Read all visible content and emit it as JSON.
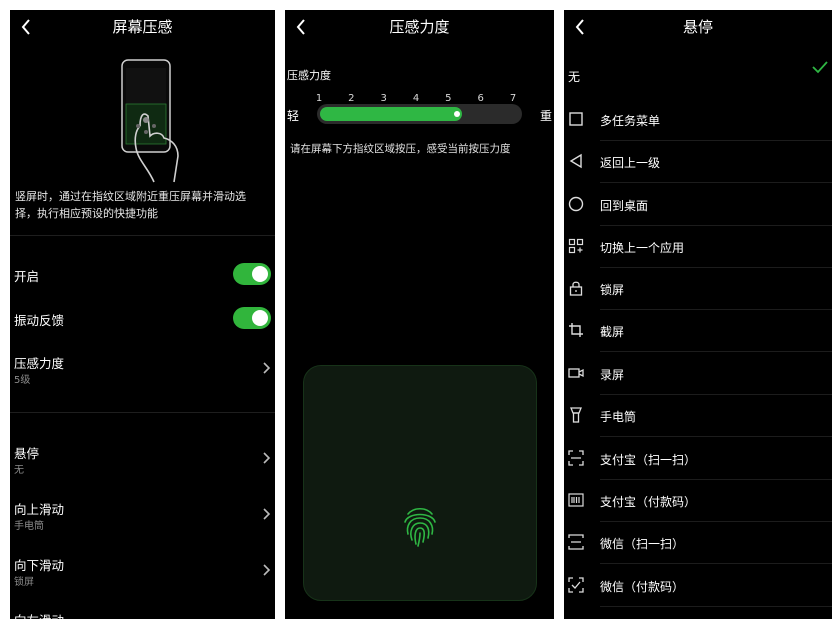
{
  "panel1": {
    "title": "屏幕压感",
    "description": "竖屏时，通过在指纹区域附近重压屏幕并滑动选择，执行相应预设的快捷功能",
    "enable_label": "开启",
    "vibration_label": "振动反馈",
    "pressure_label": "压感力度",
    "pressure_value": "5级",
    "hover_label": "悬停",
    "hover_value": "无",
    "swipe_up_label": "向上滑动",
    "swipe_up_value": "手电筒",
    "swipe_down_label": "向下滑动",
    "swipe_down_value": "锁屏",
    "swipe_left_label": "向左滑动",
    "accent_color": "#31b53c"
  },
  "panel2": {
    "title": "压感力度",
    "section_label": "压感力度",
    "ticks": [
      "1",
      "2",
      "3",
      "4",
      "5",
      "6",
      "7"
    ],
    "light_label": "轻",
    "heavy_label": "重",
    "level": 5,
    "level_max": 7,
    "hint": "请在屏幕下方指纹区域按压，感受当前按压力度"
  },
  "panel3": {
    "title": "悬停",
    "options": [
      {
        "label": "无",
        "icon": "none",
        "selected": true
      },
      {
        "label": "多任务菜单",
        "icon": "square-icon"
      },
      {
        "label": "返回上一级",
        "icon": "triangle-back-icon"
      },
      {
        "label": "回到桌面",
        "icon": "circle-home-icon"
      },
      {
        "label": "切换上一个应用",
        "icon": "grid-switch-icon"
      },
      {
        "label": "锁屏",
        "icon": "lock-icon"
      },
      {
        "label": "截屏",
        "icon": "crop-icon"
      },
      {
        "label": "录屏",
        "icon": "video-icon"
      },
      {
        "label": "手电筒",
        "icon": "flashlight-icon"
      },
      {
        "label": "支付宝（扫一扫）",
        "icon": "scan-icon"
      },
      {
        "label": "支付宝（付款码）",
        "icon": "barcode-icon"
      },
      {
        "label": "微信（扫一扫）",
        "icon": "scan-line-icon"
      },
      {
        "label": "微信（付款码）",
        "icon": "scan-check-icon"
      }
    ]
  }
}
